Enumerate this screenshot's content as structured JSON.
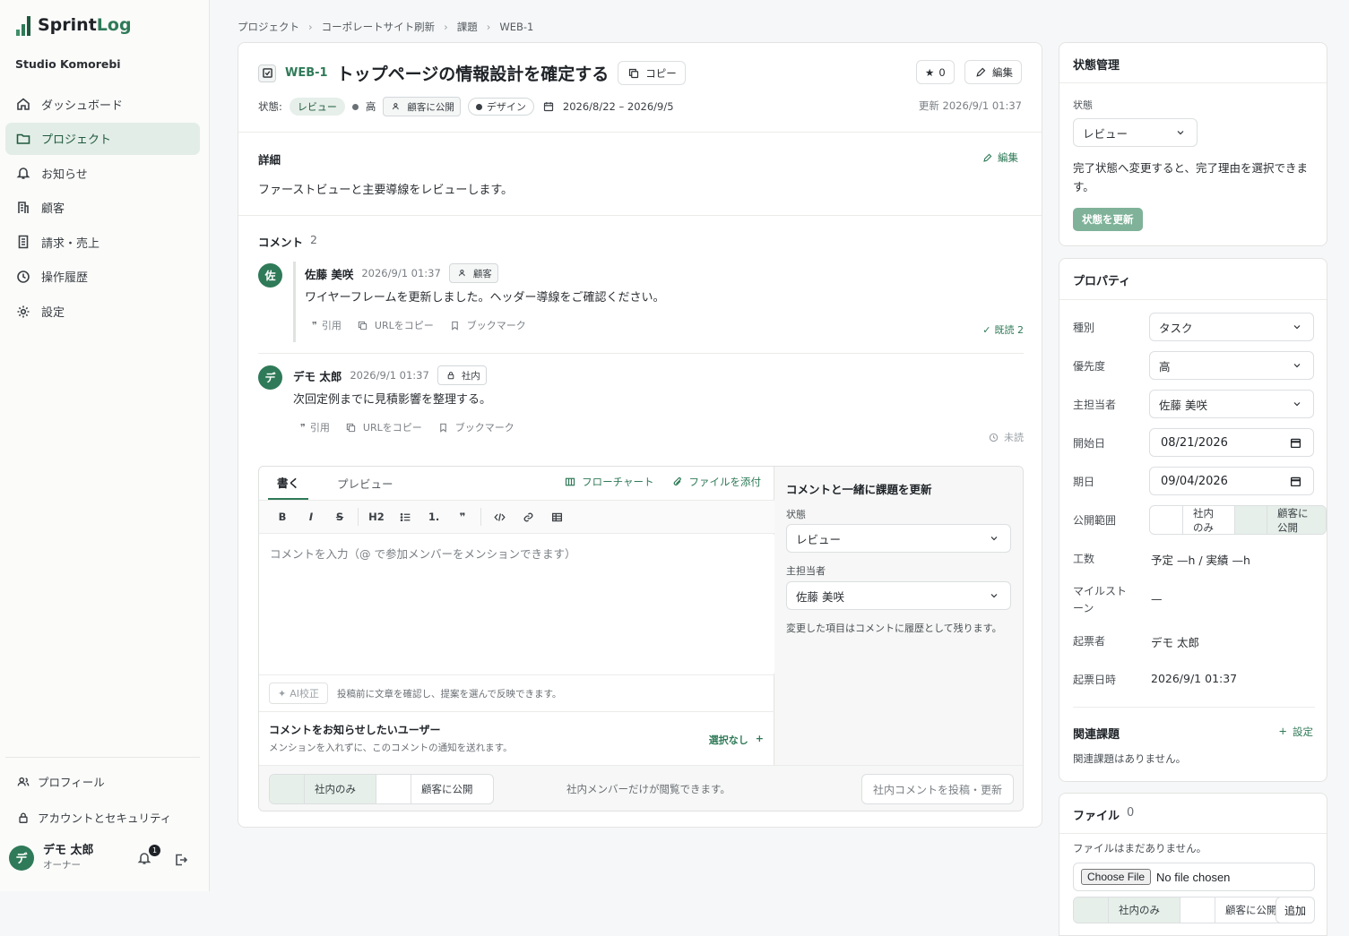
{
  "app": {
    "name_prefix": "Sprint",
    "name_suffix": "Log",
    "org": "Studio Komorebi"
  },
  "nav": {
    "items": [
      {
        "label": "ダッシュボード",
        "icon": "home-icon"
      },
      {
        "label": "プロジェクト",
        "icon": "folder-icon",
        "active": true
      },
      {
        "label": "お知らせ",
        "icon": "bell-icon"
      },
      {
        "label": "顧客",
        "icon": "building-icon"
      },
      {
        "label": "請求・売上",
        "icon": "receipt-icon"
      },
      {
        "label": "操作履歴",
        "icon": "clock-icon"
      },
      {
        "label": "設定",
        "icon": "gear-icon"
      }
    ],
    "profile": "プロフィール",
    "account": "アカウントとセキュリティ"
  },
  "user": {
    "initial": "デ",
    "name": "デモ 太郎",
    "role": "オーナー",
    "notifications": "1"
  },
  "breadcrumb": [
    "プロジェクト",
    "コーポレートサイト刷新",
    "課題",
    "WEB-1"
  ],
  "issue": {
    "key": "WEB-1",
    "title": "トップページの情報設計を確定する",
    "copy_label": "コピー",
    "stars": "0",
    "edit_label": "編集",
    "status_label": "状態:",
    "status": "レビュー",
    "priority": "高",
    "visibility_tag": "顧客に公開",
    "category": "デザイン",
    "date_range": "2026/8/22 – 2026/9/5",
    "updated": "更新 2026/9/1 01:37"
  },
  "detail": {
    "title": "詳細",
    "edit_label": "編集",
    "text": "ファーストビューと主要導線をレビューします。"
  },
  "comments": {
    "title": "コメント",
    "count": "2",
    "items": [
      {
        "initial": "佐",
        "author": "佐藤 美咲",
        "time": "2026/9/1 01:37",
        "badge": "顧客",
        "body": "ワイヤーフレームを更新しました。ヘッダー導線をご確認ください。",
        "actions": [
          "引用",
          "URLをコピー",
          "ブックマーク"
        ],
        "read": "既読 2"
      },
      {
        "initial": "デ",
        "author": "デモ 太郎",
        "time": "2026/9/1 01:37",
        "badge": "社内",
        "body": "次回定例までに見積影響を整理する。",
        "actions": [
          "引用",
          "URLをコピー",
          "ブックマーク"
        ],
        "read": "未読"
      }
    ]
  },
  "editor": {
    "tab_write": "書く",
    "tab_preview": "プレビュー",
    "flowchart": "フローチャート",
    "attach": "ファイルを添付",
    "toolbar": [
      "B",
      "I",
      "S",
      "H2"
    ],
    "placeholder": "コメントを入力（@ で参加メンバーをメンションできます）",
    "ai_label": "AI校正",
    "ai_note": "投稿前に文章を確認し、提案を選んで反映できます。",
    "notify_title": "コメントをお知らせしたいユーザー",
    "notify_sub": "メンションを入れずに、このコメントの通知を送れます。",
    "notify_select": "選択なし",
    "side_title": "コメントと一緒に課題を更新",
    "side_status_label": "状態",
    "side_status": "レビュー",
    "side_assignee_label": "主担当者",
    "side_assignee": "佐藤 美咲",
    "side_note": "変更した項目はコメントに履歴として残ります。",
    "internal": "社内のみ",
    "public": "顧客に公開",
    "footer_note": "社内メンバーだけが閲覧できます。",
    "post_label": "社内コメントを投稿・更新"
  },
  "state_panel": {
    "title": "状態管理",
    "label": "状態",
    "value": "レビュー",
    "note": "完了状態へ変更すると、完了理由を選択できます。",
    "button": "状態を更新"
  },
  "properties": {
    "title": "プロパティ",
    "type_label": "種別",
    "type": "タスク",
    "priority_label": "優先度",
    "priority": "高",
    "assignee_label": "主担当者",
    "assignee": "佐藤 美咲",
    "start_label": "開始日",
    "start": "08/21/2026",
    "due_label": "期日",
    "due": "09/04/2026",
    "visibility_label": "公開範囲",
    "vis_internal": "社内のみ",
    "vis_public": "顧客に公開",
    "effort_label": "工数",
    "effort": "予定 —h / 実績 —h",
    "milestone_label": "マイルストーン",
    "milestone": "—",
    "reporter_label": "起票者",
    "reporter": "デモ 太郎",
    "created_label": "起票日時",
    "created": "2026/9/1 01:37",
    "related_title": "関連課題",
    "related_set": "設定",
    "related_empty": "関連課題はありません。"
  },
  "files": {
    "title": "ファイル",
    "count": "0",
    "empty": "ファイルはまだありません。",
    "choose": "Choose File",
    "no_file": "No file chosen",
    "internal": "社内のみ",
    "public": "顧客に公開",
    "add": "追加"
  },
  "colors": {
    "accent": "#2f7a58",
    "accent_soft": "#e6efe9",
    "button_muted": "#7fb299"
  }
}
